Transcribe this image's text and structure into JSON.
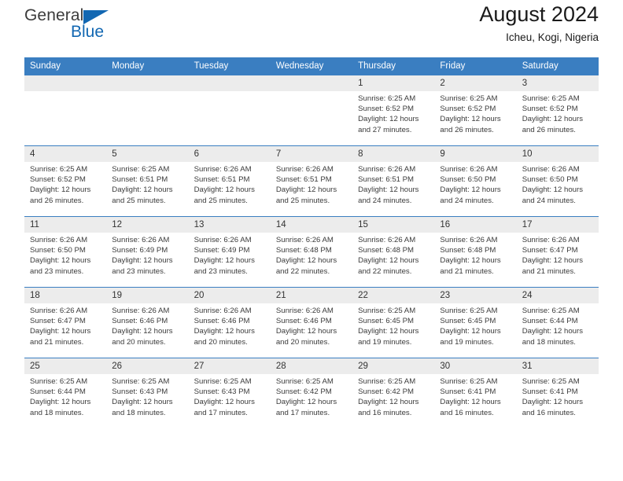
{
  "brand": {
    "name_top": "General",
    "name_bottom": "Blue",
    "triangle_color": "#1267b2"
  },
  "header": {
    "title": "August 2024",
    "location": "Icheu, Kogi, Nigeria"
  },
  "theme": {
    "header_blue": "#3a7ec1",
    "daynum_gray": "#ececec",
    "text": "#3b3b3b"
  },
  "weekday_headers": [
    "Sunday",
    "Monday",
    "Tuesday",
    "Wednesday",
    "Thursday",
    "Friday",
    "Saturday"
  ],
  "weeks": [
    [
      {
        "day": "",
        "sunrise": "",
        "sunset": "",
        "daylight": "",
        "empty": true
      },
      {
        "day": "",
        "sunrise": "",
        "sunset": "",
        "daylight": "",
        "empty": true
      },
      {
        "day": "",
        "sunrise": "",
        "sunset": "",
        "daylight": "",
        "empty": true
      },
      {
        "day": "",
        "sunrise": "",
        "sunset": "",
        "daylight": "",
        "empty": true
      },
      {
        "day": "1",
        "sunrise": "Sunrise: 6:25 AM",
        "sunset": "Sunset: 6:52 PM",
        "daylight": "Daylight: 12 hours and 27 minutes.",
        "empty": false
      },
      {
        "day": "2",
        "sunrise": "Sunrise: 6:25 AM",
        "sunset": "Sunset: 6:52 PM",
        "daylight": "Daylight: 12 hours and 26 minutes.",
        "empty": false
      },
      {
        "day": "3",
        "sunrise": "Sunrise: 6:25 AM",
        "sunset": "Sunset: 6:52 PM",
        "daylight": "Daylight: 12 hours and 26 minutes.",
        "empty": false
      }
    ],
    [
      {
        "day": "4",
        "sunrise": "Sunrise: 6:25 AM",
        "sunset": "Sunset: 6:52 PM",
        "daylight": "Daylight: 12 hours and 26 minutes.",
        "empty": false
      },
      {
        "day": "5",
        "sunrise": "Sunrise: 6:25 AM",
        "sunset": "Sunset: 6:51 PM",
        "daylight": "Daylight: 12 hours and 25 minutes.",
        "empty": false
      },
      {
        "day": "6",
        "sunrise": "Sunrise: 6:26 AM",
        "sunset": "Sunset: 6:51 PM",
        "daylight": "Daylight: 12 hours and 25 minutes.",
        "empty": false
      },
      {
        "day": "7",
        "sunrise": "Sunrise: 6:26 AM",
        "sunset": "Sunset: 6:51 PM",
        "daylight": "Daylight: 12 hours and 25 minutes.",
        "empty": false
      },
      {
        "day": "8",
        "sunrise": "Sunrise: 6:26 AM",
        "sunset": "Sunset: 6:51 PM",
        "daylight": "Daylight: 12 hours and 24 minutes.",
        "empty": false
      },
      {
        "day": "9",
        "sunrise": "Sunrise: 6:26 AM",
        "sunset": "Sunset: 6:50 PM",
        "daylight": "Daylight: 12 hours and 24 minutes.",
        "empty": false
      },
      {
        "day": "10",
        "sunrise": "Sunrise: 6:26 AM",
        "sunset": "Sunset: 6:50 PM",
        "daylight": "Daylight: 12 hours and 24 minutes.",
        "empty": false
      }
    ],
    [
      {
        "day": "11",
        "sunrise": "Sunrise: 6:26 AM",
        "sunset": "Sunset: 6:50 PM",
        "daylight": "Daylight: 12 hours and 23 minutes.",
        "empty": false
      },
      {
        "day": "12",
        "sunrise": "Sunrise: 6:26 AM",
        "sunset": "Sunset: 6:49 PM",
        "daylight": "Daylight: 12 hours and 23 minutes.",
        "empty": false
      },
      {
        "day": "13",
        "sunrise": "Sunrise: 6:26 AM",
        "sunset": "Sunset: 6:49 PM",
        "daylight": "Daylight: 12 hours and 23 minutes.",
        "empty": false
      },
      {
        "day": "14",
        "sunrise": "Sunrise: 6:26 AM",
        "sunset": "Sunset: 6:48 PM",
        "daylight": "Daylight: 12 hours and 22 minutes.",
        "empty": false
      },
      {
        "day": "15",
        "sunrise": "Sunrise: 6:26 AM",
        "sunset": "Sunset: 6:48 PM",
        "daylight": "Daylight: 12 hours and 22 minutes.",
        "empty": false
      },
      {
        "day": "16",
        "sunrise": "Sunrise: 6:26 AM",
        "sunset": "Sunset: 6:48 PM",
        "daylight": "Daylight: 12 hours and 21 minutes.",
        "empty": false
      },
      {
        "day": "17",
        "sunrise": "Sunrise: 6:26 AM",
        "sunset": "Sunset: 6:47 PM",
        "daylight": "Daylight: 12 hours and 21 minutes.",
        "empty": false
      }
    ],
    [
      {
        "day": "18",
        "sunrise": "Sunrise: 6:26 AM",
        "sunset": "Sunset: 6:47 PM",
        "daylight": "Daylight: 12 hours and 21 minutes.",
        "empty": false
      },
      {
        "day": "19",
        "sunrise": "Sunrise: 6:26 AM",
        "sunset": "Sunset: 6:46 PM",
        "daylight": "Daylight: 12 hours and 20 minutes.",
        "empty": false
      },
      {
        "day": "20",
        "sunrise": "Sunrise: 6:26 AM",
        "sunset": "Sunset: 6:46 PM",
        "daylight": "Daylight: 12 hours and 20 minutes.",
        "empty": false
      },
      {
        "day": "21",
        "sunrise": "Sunrise: 6:26 AM",
        "sunset": "Sunset: 6:46 PM",
        "daylight": "Daylight: 12 hours and 20 minutes.",
        "empty": false
      },
      {
        "day": "22",
        "sunrise": "Sunrise: 6:25 AM",
        "sunset": "Sunset: 6:45 PM",
        "daylight": "Daylight: 12 hours and 19 minutes.",
        "empty": false
      },
      {
        "day": "23",
        "sunrise": "Sunrise: 6:25 AM",
        "sunset": "Sunset: 6:45 PM",
        "daylight": "Daylight: 12 hours and 19 minutes.",
        "empty": false
      },
      {
        "day": "24",
        "sunrise": "Sunrise: 6:25 AM",
        "sunset": "Sunset: 6:44 PM",
        "daylight": "Daylight: 12 hours and 18 minutes.",
        "empty": false
      }
    ],
    [
      {
        "day": "25",
        "sunrise": "Sunrise: 6:25 AM",
        "sunset": "Sunset: 6:44 PM",
        "daylight": "Daylight: 12 hours and 18 minutes.",
        "empty": false
      },
      {
        "day": "26",
        "sunrise": "Sunrise: 6:25 AM",
        "sunset": "Sunset: 6:43 PM",
        "daylight": "Daylight: 12 hours and 18 minutes.",
        "empty": false
      },
      {
        "day": "27",
        "sunrise": "Sunrise: 6:25 AM",
        "sunset": "Sunset: 6:43 PM",
        "daylight": "Daylight: 12 hours and 17 minutes.",
        "empty": false
      },
      {
        "day": "28",
        "sunrise": "Sunrise: 6:25 AM",
        "sunset": "Sunset: 6:42 PM",
        "daylight": "Daylight: 12 hours and 17 minutes.",
        "empty": false
      },
      {
        "day": "29",
        "sunrise": "Sunrise: 6:25 AM",
        "sunset": "Sunset: 6:42 PM",
        "daylight": "Daylight: 12 hours and 16 minutes.",
        "empty": false
      },
      {
        "day": "30",
        "sunrise": "Sunrise: 6:25 AM",
        "sunset": "Sunset: 6:41 PM",
        "daylight": "Daylight: 12 hours and 16 minutes.",
        "empty": false
      },
      {
        "day": "31",
        "sunrise": "Sunrise: 6:25 AM",
        "sunset": "Sunset: 6:41 PM",
        "daylight": "Daylight: 12 hours and 16 minutes.",
        "empty": false
      }
    ]
  ]
}
